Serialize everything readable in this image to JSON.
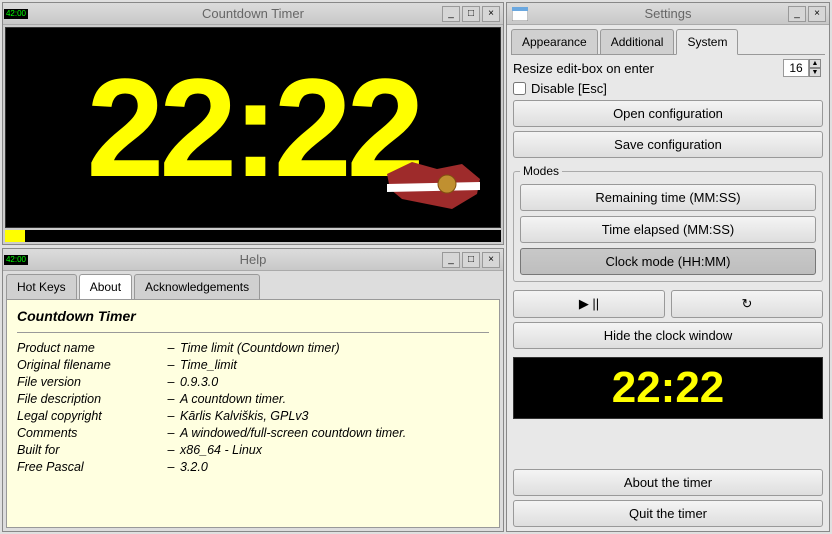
{
  "timer": {
    "title": "Countdown Timer",
    "icon_label": "42:00",
    "digits": "22:22",
    "progress_pct": 4
  },
  "help": {
    "title": "Help",
    "icon_label": "42:00",
    "tabs": [
      "Hot Keys",
      "About",
      "Acknowledgements"
    ],
    "active_tab": 1,
    "about_title": "Countdown Timer",
    "rows": [
      {
        "label": "Product name",
        "value": "Time limit (Countdown timer)"
      },
      {
        "label": "Original filename",
        "value": "Time_limit"
      },
      {
        "label": "File version",
        "value": "0.9.3.0"
      },
      {
        "label": "File description",
        "value": "A countdown timer."
      },
      {
        "label": "Legal copyright",
        "value": "Kārlis Kalviškis, GPLv3"
      },
      {
        "label": "Comments",
        "value": "A windowed/full-screen countdown timer."
      },
      {
        "label": "Built for",
        "value": "x86_64 - Linux"
      },
      {
        "label": "Free Pascal",
        "value": "3.2.0"
      }
    ]
  },
  "settings": {
    "title": "Settings",
    "tabs": [
      "Appearance",
      "Additional",
      "System"
    ],
    "active_tab": 2,
    "resize_label": "Resize edit-box on enter",
    "resize_value": "16",
    "disable_esc_label": "Disable [Esc]",
    "disable_esc_checked": false,
    "open_config": "Open configuration",
    "save_config": "Save configuration",
    "modes_legend": "Modes",
    "mode_remaining": "Remaining time (MM:SS)",
    "mode_elapsed": "Time elapsed (MM:SS)",
    "mode_clock": "Clock mode (HH:MM)",
    "play_pause": "▶ ||",
    "reload": "↻",
    "hide_clock": "Hide the clock window",
    "mini_digits": "22:22",
    "about_timer": "About the timer",
    "quit_timer": "Quit the timer"
  }
}
